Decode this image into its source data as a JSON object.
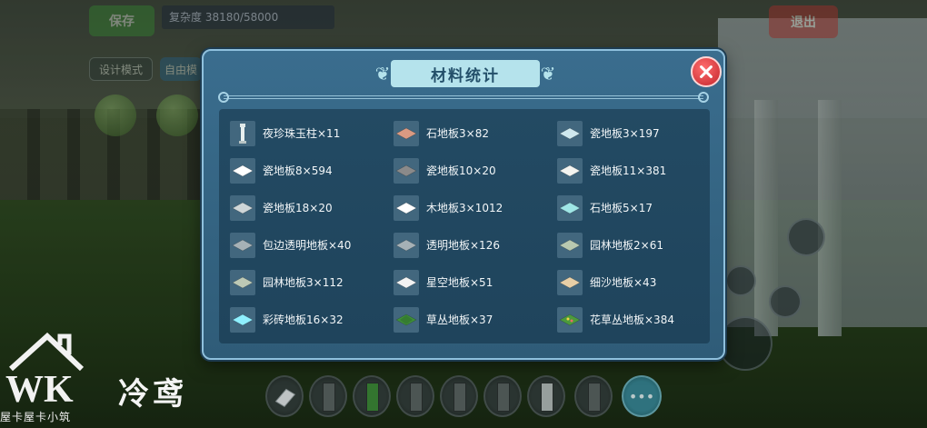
{
  "background": {
    "save_label": "保存",
    "exit_label": "退出",
    "complexity_label": "复杂度 38180/58000",
    "design_mode_label": "设计模式",
    "free_label": "自由模"
  },
  "modal": {
    "title": "材料统计",
    "close_icon": "close-x-icon",
    "items": [
      {
        "label": "夜珍珠玉柱×11",
        "icon": "pillar-icon",
        "color": "#e8f0f0"
      },
      {
        "label": "石地板3×82",
        "icon": "tile-icon",
        "color": "#d99a82"
      },
      {
        "label": "瓷地板3×197",
        "icon": "tile-icon",
        "color": "#cfe8ee"
      },
      {
        "label": "瓷地板8×594",
        "icon": "tile-icon",
        "color": "#ffffff"
      },
      {
        "label": "瓷地板10×20",
        "icon": "tile-icon",
        "color": "#8a8a8a"
      },
      {
        "label": "瓷地板11×381",
        "icon": "tile-icon",
        "color": "#f4f4f0"
      },
      {
        "label": "瓷地板18×20",
        "icon": "tile-icon",
        "color": "#cfd6d8"
      },
      {
        "label": "木地板3×1012",
        "icon": "tile-icon",
        "color": "#ffffff"
      },
      {
        "label": "石地板5×17",
        "icon": "tile-icon",
        "color": "#9fe6e6"
      },
      {
        "label": "包边透明地板×40",
        "icon": "tile-icon",
        "color": "#a6b1b6"
      },
      {
        "label": "透明地板×126",
        "icon": "tile-icon",
        "color": "#a6b1b6"
      },
      {
        "label": "园林地板2×61",
        "icon": "tile-icon",
        "color": "#b9c9b0"
      },
      {
        "label": "园林地板3×112",
        "icon": "tile-icon",
        "color": "#bdc9b5"
      },
      {
        "label": "星空地板×51",
        "icon": "tile-icon",
        "color": "#f2f2f2"
      },
      {
        "label": "细沙地板×43",
        "icon": "tile-icon",
        "color": "#e8cfa6"
      },
      {
        "label": "彩砖地板16×32",
        "icon": "tile-icon",
        "color": "#8ff0ff"
      },
      {
        "label": "草丛地板×37",
        "icon": "grass-tile-icon",
        "color": "#3f8f3a"
      },
      {
        "label": "花草丛地板×384",
        "icon": "flower-grass-tile-icon",
        "color": "#4c9a3c"
      }
    ]
  },
  "watermark": {
    "logo_text": "WK",
    "name": "冷鸢",
    "small_text": "屋卡屋卡小筑"
  }
}
